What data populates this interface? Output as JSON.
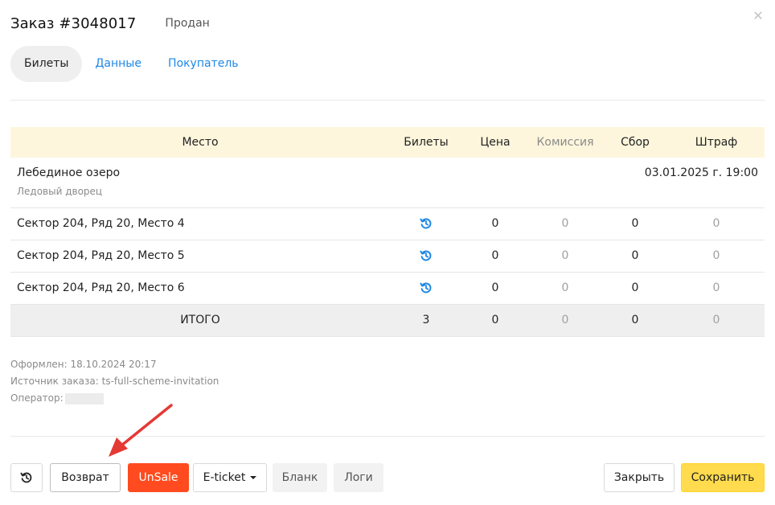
{
  "order": {
    "title": "Заказ #3048017",
    "status": "Продан"
  },
  "tabs": [
    {
      "label": "Билеты",
      "active": true
    },
    {
      "label": "Данные",
      "active": false
    },
    {
      "label": "Покупатель",
      "active": false
    }
  ],
  "table": {
    "headers": {
      "place": "Место",
      "tickets": "Билеты",
      "price": "Цена",
      "commission": "Комиссия",
      "fee": "Сбор",
      "fine": "Штраф"
    },
    "event": {
      "name": "Лебединое озеро",
      "venue": "Ледовый дворец",
      "date": "03.01.2025 г. 19:00"
    },
    "rows": [
      {
        "place": "Сектор 204, Ряд 20, Место 4",
        "price": "0",
        "commission": "0",
        "fee": "0",
        "fine": "0"
      },
      {
        "place": "Сектор 204, Ряд 20, Место 5",
        "price": "0",
        "commission": "0",
        "fee": "0",
        "fine": "0"
      },
      {
        "place": "Сектор 204, Ряд 20, Место 6",
        "price": "0",
        "commission": "0",
        "fee": "0",
        "fine": "0"
      }
    ],
    "total": {
      "label": "ИТОГО",
      "tickets": "3",
      "price": "0",
      "commission": "0",
      "fee": "0",
      "fine": "0"
    }
  },
  "meta": {
    "created": "Оформлен: 18.10.2024 20:17",
    "source": "Источник заказа: ts-full-scheme-invitation",
    "operator_label": "Оператор:"
  },
  "footer": {
    "refund": "Возврат",
    "unsale": "UnSale",
    "eticket": "E-ticket",
    "blank": "Бланк",
    "logs": "Логи",
    "close": "Закрыть",
    "save": "Сохранить"
  },
  "icons": {
    "close": "close-icon",
    "return": "history-icon",
    "arrow": "annotation-arrow"
  },
  "colors": {
    "accent": "#1e88e5",
    "danger": "#ff4b1f",
    "primary": "#ffdb4d",
    "header_bg": "#fdf6dc",
    "annotation": "#e53935"
  }
}
